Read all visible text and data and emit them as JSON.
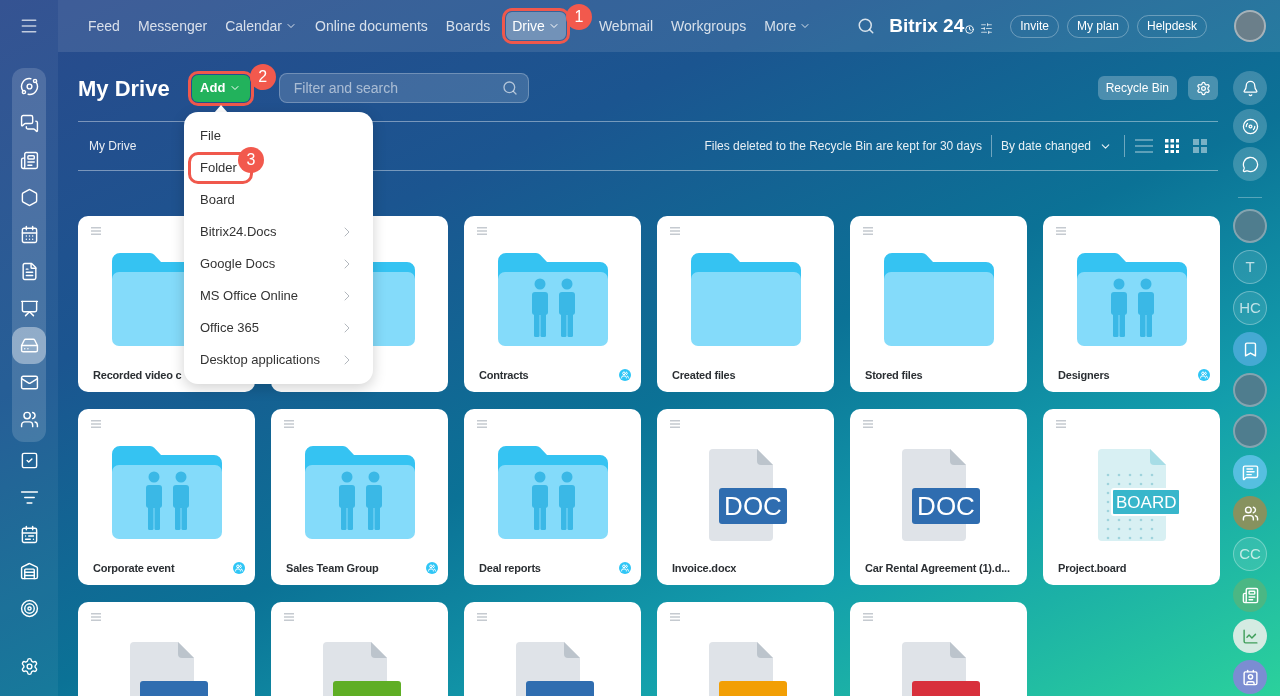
{
  "top_bar": {
    "nav": [
      {
        "label": "Feed",
        "dropdown": false,
        "selected": false
      },
      {
        "label": "Messenger",
        "dropdown": false,
        "selected": false
      },
      {
        "label": "Calendar",
        "dropdown": true,
        "selected": false
      },
      {
        "label": "Online documents",
        "dropdown": false,
        "selected": false
      },
      {
        "label": "Boards",
        "dropdown": false,
        "selected": false
      },
      {
        "label": "Drive",
        "dropdown": true,
        "selected": true,
        "annotation": "1"
      },
      {
        "label": "Webmail",
        "dropdown": false,
        "selected": false
      },
      {
        "label": "Workgroups",
        "dropdown": false,
        "selected": false
      },
      {
        "label": "More",
        "dropdown": true,
        "selected": false
      }
    ],
    "logo": "Bitrix 24",
    "buttons": [
      "Invite",
      "My plan",
      "Helpdesk"
    ]
  },
  "left_sidebar": {
    "pinned": [
      {
        "kind": "flow",
        "selected": false
      },
      {
        "kind": "chat",
        "selected": false
      },
      {
        "kind": "news",
        "selected": false
      },
      {
        "kind": "hexagon",
        "selected": false
      },
      {
        "kind": "calendar",
        "selected": false
      },
      {
        "kind": "document",
        "selected": false
      },
      {
        "kind": "presentation",
        "selected": false
      },
      {
        "kind": "drive",
        "selected": true
      },
      {
        "kind": "mail",
        "selected": false
      },
      {
        "kind": "people",
        "selected": false
      }
    ],
    "items": [
      {
        "kind": "tasks",
        "selected": false
      },
      {
        "kind": "funnel",
        "selected": false
      },
      {
        "kind": "schedule",
        "selected": false
      },
      {
        "kind": "warehouse",
        "selected": false
      },
      {
        "kind": "target",
        "selected": false
      }
    ],
    "footer": [
      {
        "kind": "settings",
        "selected": false
      }
    ]
  },
  "header": {
    "title": "My Drive",
    "add_button": {
      "label": "Add",
      "annotation": "2"
    },
    "search": {
      "placeholder": "Filter and search"
    },
    "recycle_bin_button": "Recycle Bin"
  },
  "toolbar": {
    "breadcrumb": "My Drive",
    "notice": "Files deleted to the Recycle Bin are kept for 30 days",
    "sort": "By date changed",
    "views": [
      {
        "kind": "list",
        "selected": false
      },
      {
        "kind": "tiles",
        "selected": true
      },
      {
        "kind": "large",
        "selected": false
      }
    ]
  },
  "add_menu": {
    "items": [
      {
        "label": "File",
        "submenu": false
      },
      {
        "label": "Folder",
        "submenu": false,
        "annotation": "3"
      },
      {
        "label": "Board",
        "submenu": false
      },
      {
        "label": "Bitrix24.Docs",
        "submenu": true
      },
      {
        "label": "Google Docs",
        "submenu": true
      },
      {
        "label": "MS Office Online",
        "submenu": true
      },
      {
        "label": "Office 365",
        "submenu": true
      },
      {
        "label": "Desktop applications",
        "submenu": true
      }
    ]
  },
  "files": [
    {
      "kind": "folder",
      "name": "Recorded video c",
      "shared": false
    },
    {
      "kind": "folder",
      "shared": false
    },
    {
      "kind": "group",
      "name": "Contracts",
      "shared": true
    },
    {
      "kind": "folder",
      "name": "Created files",
      "shared": false
    },
    {
      "kind": "folder",
      "name": "Stored files",
      "shared": false
    },
    {
      "kind": "group",
      "name": "Designers",
      "shared": true
    },
    {
      "kind": "group",
      "name": "Corporate event",
      "shared": true
    },
    {
      "kind": "group",
      "name": "Sales Team Group",
      "shared": true
    },
    {
      "kind": "group",
      "name": "Deal reports",
      "shared": true
    },
    {
      "kind": "file",
      "type": "DOC",
      "color": "#2f6db0",
      "name": "Invoice.docx",
      "shared": false
    },
    {
      "kind": "file",
      "type": "DOC",
      "color": "#2f6db0",
      "name": "Car Rental Agreement (1).d...",
      "shared": false
    },
    {
      "kind": "board",
      "type": "BOARD",
      "color": "#38b6cb",
      "name": "Project.board",
      "shared": false
    },
    {
      "kind": "file",
      "color": "#2f6db0"
    },
    {
      "kind": "file",
      "color": "#5fae25"
    },
    {
      "kind": "file",
      "color": "#2f6db0"
    },
    {
      "kind": "file",
      "color": "#f29f05"
    },
    {
      "kind": "file",
      "color": "#d8303c"
    }
  ],
  "right_sidebar": {
    "tools": [
      {
        "kind": "bell"
      },
      {
        "kind": "disc"
      },
      {
        "kind": "chat"
      }
    ],
    "contacts": [
      {
        "kind": "photo"
      },
      {
        "kind": "initials",
        "text": "T"
      },
      {
        "kind": "initials",
        "text": "HC"
      },
      {
        "kind": "bookmark"
      },
      {
        "kind": "photo"
      },
      {
        "kind": "photo"
      },
      {
        "kind": "chat"
      },
      {
        "kind": "group"
      },
      {
        "kind": "initials",
        "text": "CC"
      },
      {
        "kind": "news"
      },
      {
        "kind": "chart"
      },
      {
        "kind": "contact"
      }
    ]
  }
}
